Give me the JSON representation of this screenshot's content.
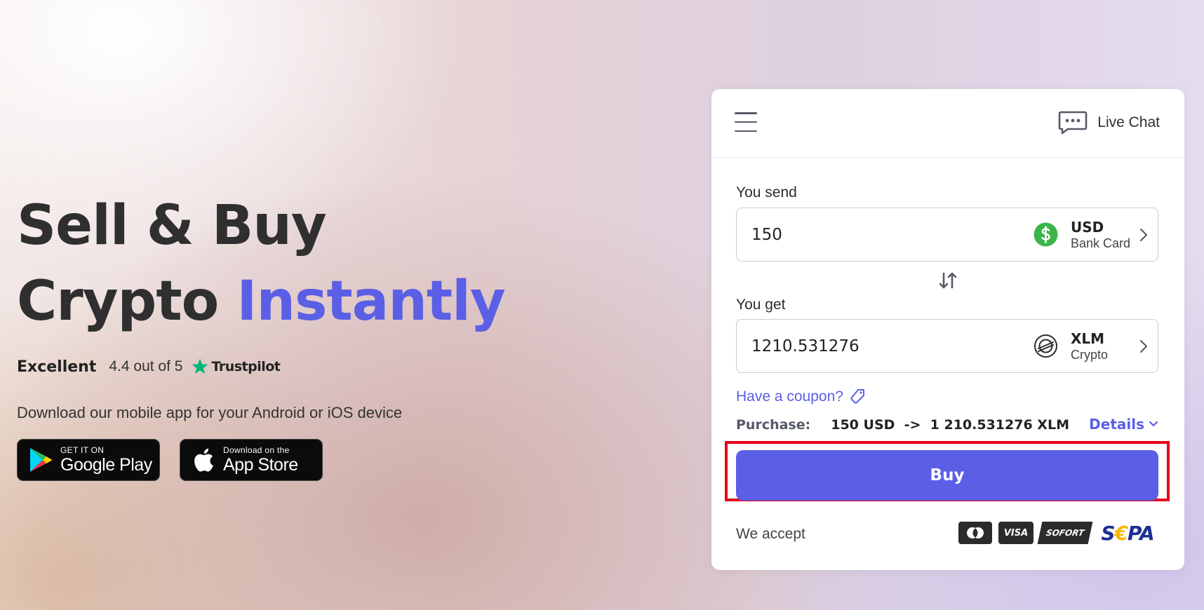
{
  "hero": {
    "title_line1": "Sell & Buy",
    "title_line2_plain": "Crypto",
    "title_line2_accent": "Instantly",
    "accent_color": "#5b5fe6"
  },
  "rating": {
    "label": "Excellent",
    "score": "4.4 out of 5",
    "provider": "Trustpilot",
    "star_color": "#00b67a",
    "icon": "star-icon"
  },
  "download": {
    "text": "Download our mobile app for your Android or iOS device",
    "google_play": {
      "small": "GET IT ON",
      "big": "Google Play",
      "icon": "google-play-icon"
    },
    "app_store": {
      "small": "Download on the",
      "big": "App Store",
      "icon": "apple-icon"
    }
  },
  "widget": {
    "menu_icon": "hamburger-menu-icon",
    "live_chat": {
      "label": "Live Chat",
      "icon": "chat-bubble-icon"
    },
    "send": {
      "label": "You send",
      "amount": "150",
      "currency_code": "USD",
      "currency_sub": "Bank Card",
      "icon": "dollar-icon",
      "icon_color": "#3bb54a"
    },
    "swap_icon": "swap-arrows-icon",
    "get": {
      "label": "You get",
      "amount": "1210.531276",
      "currency_code": "XLM",
      "currency_sub": "Crypto",
      "icon": "stellar-icon"
    },
    "coupon": {
      "label": "Have a coupon?",
      "icon": "tag-icon"
    },
    "purchase": {
      "label": "Purchase:",
      "summary": "150 USD  ->  1 210.531276 XLM",
      "details_label": "Details",
      "details_icon": "chevron-down-icon"
    },
    "buy_label": "Buy",
    "buy_color": "#5b5fe6",
    "highlight_color": "#e6001c",
    "accept": {
      "label": "We accept",
      "methods": [
        "mastercard-icon",
        "visa-icon",
        "sofort-icon",
        "sepa-icon"
      ],
      "visa_text": "VISA",
      "sofort_text": "SOFORT",
      "sepa_text_pre": "S",
      "sepa_text_euro": "€",
      "sepa_text_post": "PA"
    }
  }
}
